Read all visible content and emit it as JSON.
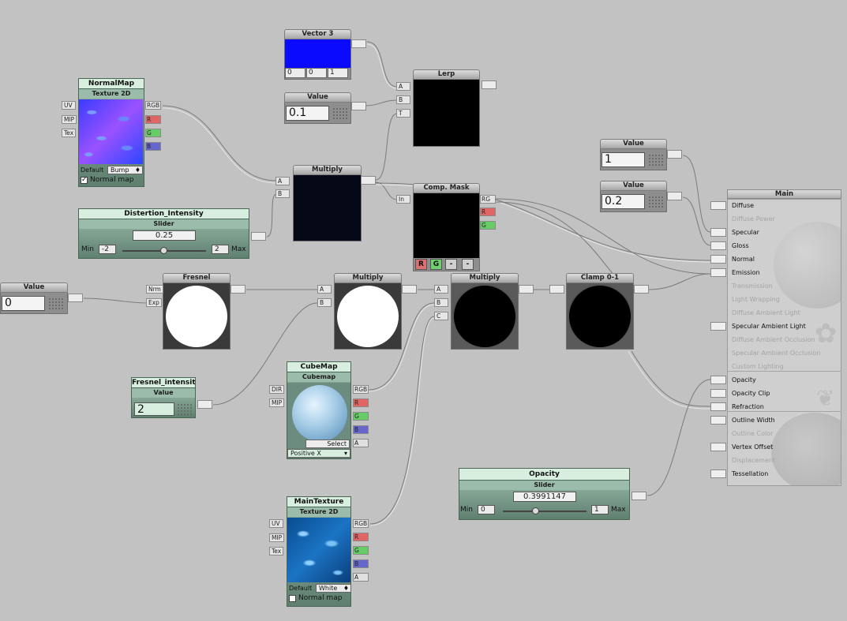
{
  "nodes": {
    "vector3": {
      "title": "Vector 3",
      "x": "0",
      "y": "0",
      "z": "1",
      "color": "#0a0aff"
    },
    "lerp": {
      "title": "Lerp",
      "inputs": [
        "A",
        "B",
        "T"
      ]
    },
    "value_01": {
      "title": "Value",
      "value": "0.1"
    },
    "normalmap": {
      "title": "NormalMap",
      "subtitle": "Texture 2D",
      "inputs": [
        "UV",
        "MIP",
        "Tex"
      ],
      "outputs": [
        "RGB",
        "R",
        "G",
        "B"
      ],
      "default_label": "Default",
      "default_value": "Bump",
      "checkbox_label": "Normal map",
      "checked": true
    },
    "multiply1": {
      "title": "Multiply",
      "inputs": [
        "A",
        "B"
      ]
    },
    "comp_mask": {
      "title": "Comp. Mask",
      "input": "In",
      "outputs": [
        "RG",
        "R",
        "G"
      ],
      "buttons": [
        "R",
        "G",
        "-",
        "-"
      ]
    },
    "distortion": {
      "title": "Distertion_Intensity",
      "subtitle": "Slider",
      "value": "0.25",
      "min_label": "Min",
      "min": "-2",
      "max": "2",
      "max_label": "Max",
      "fraction": 0.5
    },
    "value_1": {
      "title": "Value",
      "value": "1"
    },
    "value_02": {
      "title": "Value",
      "value": "0.2"
    },
    "value_0": {
      "title": "Value",
      "value": "0"
    },
    "fresnel": {
      "title": "Fresnel",
      "inputs": [
        "Nrm",
        "Exp"
      ]
    },
    "multiply2": {
      "title": "Multiply",
      "inputs": [
        "A",
        "B"
      ]
    },
    "multiply3": {
      "title": "Multiply",
      "inputs": [
        "A",
        "B",
        "C"
      ]
    },
    "clamp": {
      "title": "Clamp 0-1"
    },
    "fresnel_intensity": {
      "title": "Fresnel_intensity",
      "subtitle": "Value",
      "value": "2"
    },
    "cubemap": {
      "title": "CubeMap",
      "subtitle": "Cubemap",
      "inputs": [
        "DIR",
        "MIP"
      ],
      "outputs": [
        "RGB",
        "R",
        "G",
        "B",
        "A"
      ],
      "select_label": "Select",
      "dropdown": "Positive X"
    },
    "maintexture": {
      "title": "MainTexture",
      "subtitle": "Texture 2D",
      "inputs": [
        "UV",
        "MIP",
        "Tex"
      ],
      "outputs": [
        "RGB",
        "R",
        "G",
        "B",
        "A"
      ],
      "default_label": "Default",
      "default_value": "White",
      "checkbox_label": "Normal map",
      "checked": false
    },
    "opacity": {
      "title": "Opacity",
      "subtitle": "Slider",
      "value": "0.3991147",
      "min_label": "Min",
      "min": "0",
      "max": "1",
      "max_label": "Max",
      "fraction": 0.3991147
    }
  },
  "main": {
    "title": "Main",
    "inputs": [
      {
        "label": "Diffuse",
        "enabled": true
      },
      {
        "label": "Diffuse Power",
        "enabled": false
      },
      {
        "label": "Specular",
        "enabled": true
      },
      {
        "label": "Gloss",
        "enabled": true
      },
      {
        "label": "Normal",
        "enabled": true
      },
      {
        "label": "Emission",
        "enabled": true
      },
      {
        "label": "Transmission",
        "enabled": false
      },
      {
        "label": "Light Wrapping",
        "enabled": false
      },
      {
        "label": "Diffuse Ambient Light",
        "enabled": false
      },
      {
        "label": "Specular Ambient Light",
        "enabled": true
      },
      {
        "label": "Diffuse Ambient Occlusion",
        "enabled": false
      },
      {
        "label": "Specular Ambient Occlusion",
        "enabled": false
      },
      {
        "label": "Custom Lighting",
        "enabled": false
      },
      {
        "label": "Opacity",
        "enabled": true
      },
      {
        "label": "Opacity Clip",
        "enabled": true
      },
      {
        "label": "Refraction",
        "enabled": true
      },
      {
        "label": "Outline Width",
        "enabled": true
      },
      {
        "label": "Outline Color",
        "enabled": false
      },
      {
        "label": "Vertex Offset",
        "enabled": true
      },
      {
        "label": "Displacement",
        "enabled": false
      },
      {
        "label": "Tessellation",
        "enabled": true
      }
    ]
  },
  "colors": {
    "canvas": "#c2c2c2",
    "green_header": "#d8efdf",
    "port_r": "#e06666",
    "port_g": "#66cc66",
    "port_b": "#6666cc"
  }
}
